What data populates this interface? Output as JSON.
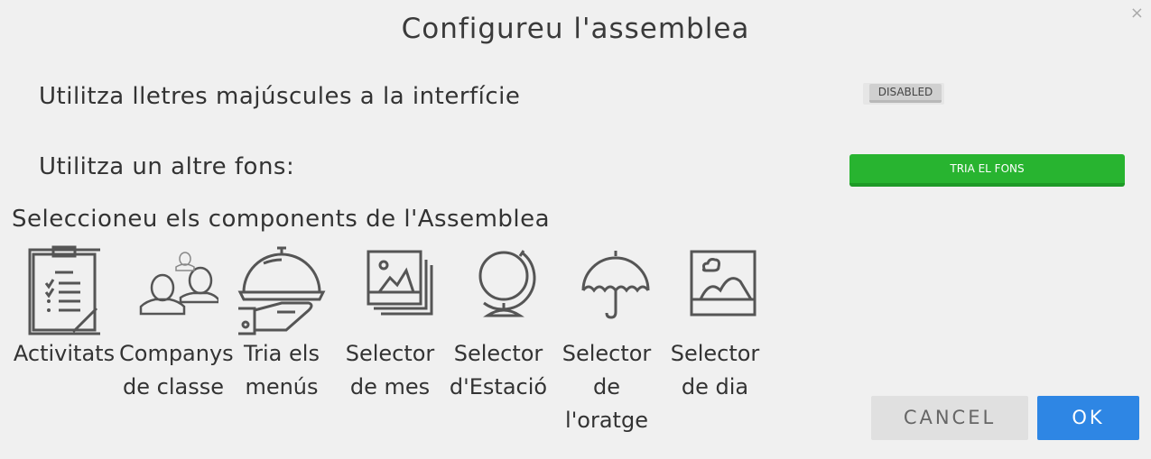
{
  "dialog": {
    "title": "Configureu l'assemblea",
    "close_icon": "×"
  },
  "settings": {
    "uppercase_label": "Utilitza lletres majúscules a la interfície",
    "uppercase_toggle": "DISABLED",
    "background_label": "Utilitza un altre fons:",
    "background_button": "TRIA EL FONS"
  },
  "components": {
    "heading": "Seleccioneu els components de l'Assemblea",
    "items": [
      {
        "label": "Activitats",
        "icon": "clipboard-icon"
      },
      {
        "label": "Companys de classe",
        "icon": "classmates-icon"
      },
      {
        "label": "Tria els menús",
        "icon": "serving-dish-icon"
      },
      {
        "label": "Selector de mes",
        "icon": "image-stack-icon"
      },
      {
        "label": "Selector d'Estació",
        "icon": "globe-icon"
      },
      {
        "label": "Selector de l'oratge",
        "icon": "umbrella-icon"
      },
      {
        "label": "Selector de dia",
        "icon": "landscape-picture-icon"
      }
    ]
  },
  "footer": {
    "cancel": "CANCEL",
    "ok": "OK"
  },
  "colors": {
    "background": "#f0f0f0",
    "green_button": "#28b430",
    "ok_button": "#2e86e4",
    "cancel_button": "#e0e0e0"
  }
}
